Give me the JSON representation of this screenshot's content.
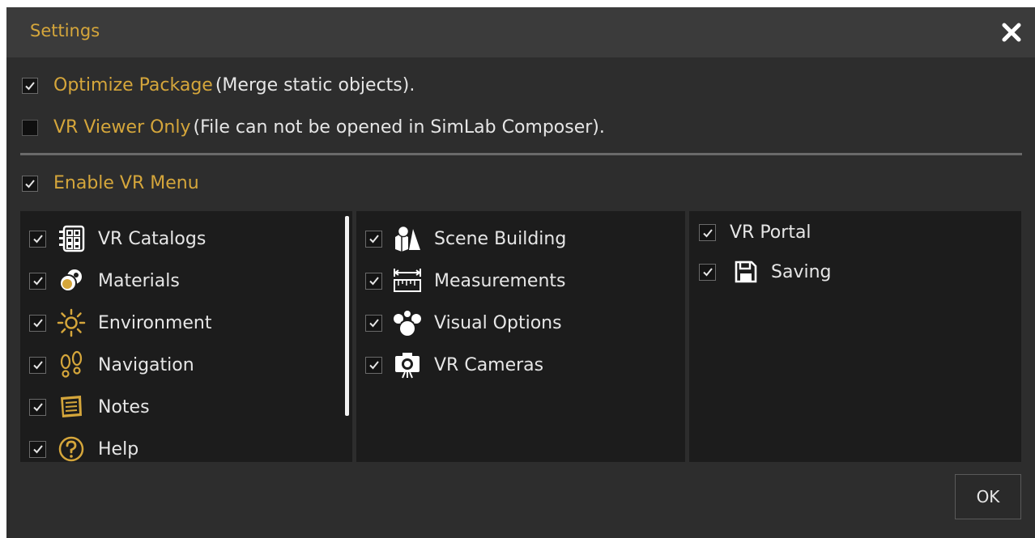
{
  "dialog": {
    "title": "Settings",
    "close_icon": "close-x-icon"
  },
  "options": {
    "optimize": {
      "checked": true,
      "label": "Optimize Package",
      "note": "(Merge static objects)."
    },
    "viewer_only": {
      "checked": false,
      "label": "VR Viewer Only",
      "note": "(File can not be opened in SimLab Composer)."
    },
    "enable_menu": {
      "checked": true,
      "label": "Enable VR Menu"
    }
  },
  "columns": [
    {
      "items": [
        {
          "label": "VR Catalogs",
          "icon": "catalog-grid-icon",
          "checked": true
        },
        {
          "label": "Materials",
          "icon": "materials-spheres-icon",
          "checked": true
        },
        {
          "label": "Environment",
          "icon": "sun-icon",
          "checked": true
        },
        {
          "label": "Navigation",
          "icon": "footprints-icon",
          "checked": true
        },
        {
          "label": "Notes",
          "icon": "notes-icon",
          "checked": true
        },
        {
          "label": "Help",
          "icon": "help-icon",
          "checked": true
        }
      ]
    },
    {
      "items": [
        {
          "label": "Scene Building",
          "icon": "shapes-icon",
          "checked": true
        },
        {
          "label": "Measurements",
          "icon": "ruler-icon",
          "checked": true
        },
        {
          "label": "Visual Options",
          "icon": "visual-options-icon",
          "checked": true
        },
        {
          "label": "VR Cameras",
          "icon": "camera-icon",
          "checked": true
        }
      ]
    },
    {
      "items": [
        {
          "label": "VR Portal",
          "icon": "",
          "checked": true
        },
        {
          "label": "Saving",
          "icon": "save-disk-icon",
          "checked": true
        }
      ]
    }
  ],
  "footer": {
    "ok_label": "OK"
  },
  "colors": {
    "accent": "#d5a63b",
    "background": "#2d2d2d",
    "titlebar": "#3b3b3b",
    "panel": "#1c1c1c",
    "text": "#e6e6e6"
  }
}
